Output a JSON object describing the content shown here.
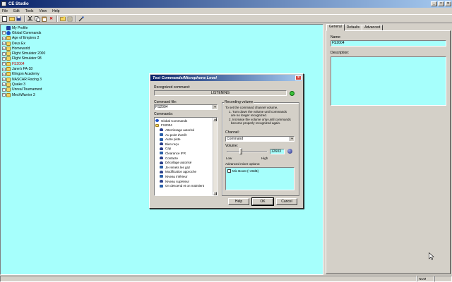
{
  "window": {
    "title": "CE Studio",
    "buttons": [
      "_",
      "□",
      "×"
    ]
  },
  "menubar": [
    "File",
    "Edit",
    "Tools",
    "View",
    "Help"
  ],
  "toolbar": {
    "icons": [
      "new-icon",
      "open-icon",
      "save-icon",
      "cut-icon",
      "copy-icon",
      "paste-icon",
      "delete-icon",
      "new-folder-icon",
      "settings-icon",
      "test-icon"
    ]
  },
  "tree": {
    "items": [
      {
        "label": "My Profile",
        "icon": "profile",
        "exp": ""
      },
      {
        "label": "Global Commands",
        "icon": "globe",
        "exp": "+"
      },
      {
        "label": "Age of Empires 2",
        "icon": "folder",
        "exp": "+"
      },
      {
        "label": "Deus Ex",
        "icon": "folder",
        "exp": "+"
      },
      {
        "label": "Homeworld",
        "icon": "folder",
        "exp": "+"
      },
      {
        "label": "Flight Simulator 2000",
        "icon": "folder",
        "exp": "+"
      },
      {
        "label": "Flight Simulator 98",
        "icon": "folder",
        "exp": "+"
      },
      {
        "label": "FS2004",
        "icon": "folder",
        "exp": "+",
        "highlight": true
      },
      {
        "label": "Jane's FA-18",
        "icon": "folder",
        "exp": "+"
      },
      {
        "label": "Klingon Academy",
        "icon": "folder",
        "exp": "+"
      },
      {
        "label": "NASCAR Racing 3",
        "icon": "folder",
        "exp": "+"
      },
      {
        "label": "Quake 3",
        "icon": "folder",
        "exp": "+"
      },
      {
        "label": "Unreal Tournament",
        "icon": "folder",
        "exp": "+"
      },
      {
        "label": "MechWarrior 3",
        "icon": "folder",
        "exp": "+"
      }
    ]
  },
  "rightpanel": {
    "tabs": [
      "General",
      "Defaults",
      "Advanced"
    ],
    "name_label": "Name:",
    "name_value": "FS2004",
    "description_label": "Description:",
    "description_value": ""
  },
  "statusbar": {
    "num": "NUM"
  },
  "dialog": {
    "title": "Test Commands/Microphone Level",
    "close": "×",
    "recognized_label": "Recognized command:",
    "recognized_value": "LISTENING",
    "command_file_label": "Command file:",
    "command_file_value": "FS2004",
    "commands_label": "Commands:",
    "commands": [
      {
        "label": "Global Commands",
        "icon": "globe",
        "indent": 0
      },
      {
        "label": "FS2004",
        "icon": "folder",
        "indent": 0
      },
      {
        "label": "Atterrissage autorisé",
        "icon": "mic",
        "indent": 1
      },
      {
        "label": "Au point d'arrêt",
        "icon": "wave",
        "indent": 1
      },
      {
        "label": "Autre piste",
        "icon": "wave",
        "indent": 1
      },
      {
        "label": "Bien reçu",
        "icon": "mic",
        "indent": 1
      },
      {
        "label": "Cap",
        "icon": "mic",
        "indent": 1
      },
      {
        "label": "Clearance IFR",
        "icon": "wave",
        "indent": 1
      },
      {
        "label": "Contacte",
        "icon": "mic",
        "indent": 1
      },
      {
        "label": "Décollage autorisé",
        "icon": "mic",
        "indent": 1
      },
      {
        "label": "Je remets les gaz",
        "icon": "wave",
        "indent": 1
      },
      {
        "label": "Modification approche",
        "icon": "mic",
        "indent": 1
      },
      {
        "label": "Niveau inférieur",
        "icon": "wave",
        "indent": 1
      },
      {
        "label": "Niveau supérieur",
        "icon": "mic",
        "indent": 1
      },
      {
        "label": "On descend et on maintient",
        "icon": "wave",
        "indent": 1
      }
    ],
    "recording_group": "Recording volume",
    "instructions": [
      "To set the command channel volume,",
      "1. Turn down the volume until commands",
      "are no longer recognized.",
      "2. Increase the volume only until commands",
      "become properly recognized again."
    ],
    "channel_label": "Channel:",
    "channel_value": "Command",
    "volume_label": "Volume:",
    "volume_value": "12603",
    "volume_level": 0.35,
    "low_label": "Low",
    "high_label": "High",
    "mixer_label": "Advanced mixer options:",
    "mic_boost_label": "Mic Boost (+20dB)",
    "mic_boost_checked": false,
    "buttons": {
      "help": "Help",
      "ok": "OK",
      "cancel": "Cancel"
    }
  }
}
